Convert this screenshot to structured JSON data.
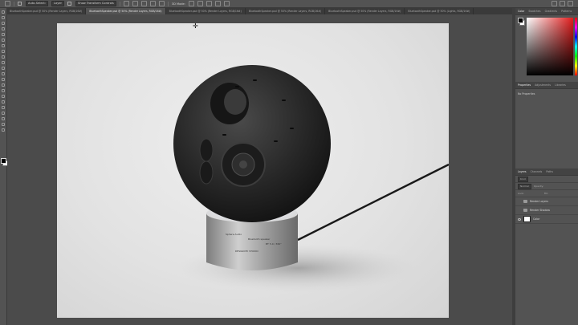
{
  "options_bar": {
    "auto_select_label": "Auto-Select:",
    "auto_select_value": "Layer",
    "transform_label": "Show Transform Controls",
    "mode_label": "3D Mode:"
  },
  "document_tabs": [
    {
      "label": "BluetoothSpeaker.psd @ 50% (Render Layers, RGB/16#)",
      "active": false
    },
    {
      "label": "BluetoothSpeaker.psd @ 50% (Render Layers, RGB/16#)",
      "active": true
    },
    {
      "label": "BluetoothSpeaker.psd @ 50% (Render Layers, RGB/16#)",
      "active": false
    },
    {
      "label": "BluetoothSpeaker.psd @ 50% (Render Layers, RGB/16#)",
      "active": false
    },
    {
      "label": "BluetoothSpeaker.psd @ 50% (Render Layers, RGB/16#)",
      "active": false
    },
    {
      "label": "BluetoothSpeaker.psd @ 50% (Lights, RGB/16#)",
      "active": false
    }
  ],
  "color_panel": {
    "tabs": [
      "Color",
      "Swatches",
      "Gradients",
      "Patterns"
    ],
    "active_tab": "Color",
    "hue_color": "#e11d1d"
  },
  "properties_panel": {
    "tabs": [
      "Properties",
      "Adjustments",
      "Libraries"
    ],
    "active_tab": "Properties",
    "message": "No Properties"
  },
  "layers_panel": {
    "tabs": [
      "Layers",
      "Channels",
      "Paths"
    ],
    "active_tab": "Layers",
    "kind_label": "Kind",
    "blend_mode": "Normal",
    "opacity_label": "Opacity:",
    "lock_label": "Lock:",
    "fill_label": "Fill:",
    "layers": [
      {
        "name": "Render Layers",
        "type": "folder",
        "visible": false
      },
      {
        "name": "Render Shadow",
        "type": "folder",
        "visible": false
      },
      {
        "name": "Color",
        "type": "fill",
        "visible": true
      }
    ]
  },
  "product": {
    "brand_line": "Sphere Audio",
    "spec_line_1": "Bluetooth speaker",
    "spec_line_2": "BT 5.0 / 360°",
    "foot_line": "DESIGN BY STUDIO"
  }
}
